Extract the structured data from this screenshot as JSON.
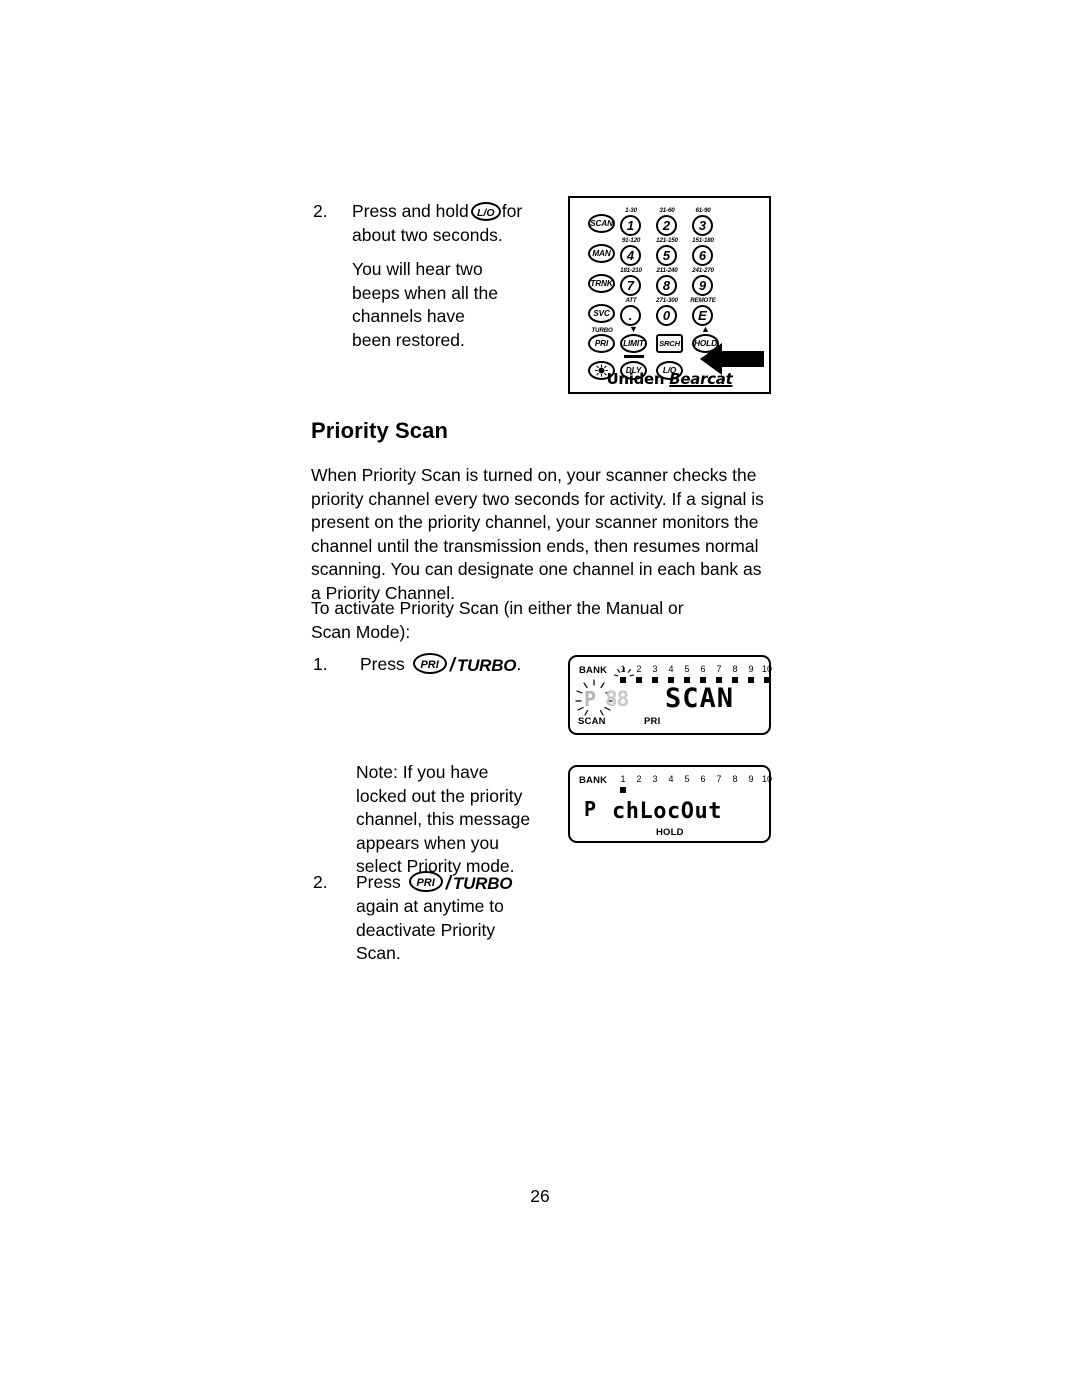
{
  "page": {
    "number": "26"
  },
  "step_restore": {
    "number": "2.",
    "line1_before": "Press and hold",
    "key_label": "L/O",
    "line1_after": "for",
    "line2": "about two seconds.",
    "para2_line1": "You will hear two",
    "para2_line2": "beeps when all the",
    "para2_line3": "channels have",
    "para2_line4": "been restored."
  },
  "section": {
    "heading": "Priority Scan",
    "paragraph_lines": [
      "When Priority Scan is turned on, your scanner checks the",
      "priority channel every two seconds for activity. If a signal is",
      "present on the priority channel, your scanner monitors the",
      "channel until the transmission ends, then resumes normal",
      "scanning. You can designate one channel in each bank as",
      "a Priority Channel."
    ],
    "activate_line1": "To activate Priority Scan (in either the Manual or",
    "activate_line2": "Scan Mode):"
  },
  "step_press_pri": {
    "number": "1.",
    "press_word": "Press",
    "key_label": "PRI",
    "slash": "/",
    "turbo_label": "TURBO",
    "period": "."
  },
  "note": {
    "line1": "Note: If you have",
    "line2": "locked out the priority",
    "line3": "channel, this message",
    "line4": "appears when you",
    "line5": "select Priority mode."
  },
  "step_deactivate": {
    "number": "2.",
    "press_word": "Press",
    "key_label": "PRI",
    "slash": "/",
    "turbo_label": "TURBO",
    "line2": "again at anytime to",
    "line3": "deactivate Priority",
    "line4": "Scan."
  },
  "keypad": {
    "brand_uniden": "Uniden",
    "brand_bearcat": "Bearcat",
    "left_column": [
      "SCAN",
      "MAN",
      "TRNK",
      "SVC",
      "PRI"
    ],
    "number_keys": [
      {
        "label": "1",
        "sublabel": "1-30"
      },
      {
        "label": "2",
        "sublabel": "31-60"
      },
      {
        "label": "3",
        "sublabel": "61-90"
      },
      {
        "label": "4",
        "sublabel": "91-120"
      },
      {
        "label": "5",
        "sublabel": "121-150"
      },
      {
        "label": "6",
        "sublabel": "151-180"
      },
      {
        "label": "7",
        "sublabel": "181-210"
      },
      {
        "label": "8",
        "sublabel": "211-240"
      },
      {
        "label": "9",
        "sublabel": "241-270"
      },
      {
        "label": ".",
        "sublabel": "ATT"
      },
      {
        "label": "0",
        "sublabel": "271-300"
      },
      {
        "label": "E",
        "sublabel": "REMOTE"
      }
    ],
    "function_row": [
      {
        "label": "PRI",
        "sublabel": "TURBO"
      },
      {
        "label": "LIMIT",
        "sublabel": ""
      },
      {
        "label": "SRCH",
        "sublabel": ""
      },
      {
        "label": "HOLD",
        "sublabel": ""
      }
    ],
    "bottom_row": [
      {
        "label": "LIGHT",
        "sublabel": ""
      },
      {
        "label": "DLY",
        "sublabel": ""
      },
      {
        "label": "L/O",
        "sublabel": ""
      }
    ]
  },
  "lcd_scan": {
    "bank_word": "BANK",
    "bank_numbers": [
      "1",
      "2",
      "3",
      "4",
      "5",
      "6",
      "7",
      "8",
      "9",
      "10"
    ],
    "active_bank": "1",
    "p_indicator": "P",
    "ghost_digits": "88",
    "main_text": "SCAN",
    "foot_left": "SCAN",
    "foot_mid": "PRI"
  },
  "lcd_lockout": {
    "bank_word": "BANK",
    "bank_numbers": [
      "1",
      "2",
      "3",
      "4",
      "5",
      "6",
      "7",
      "8",
      "9",
      "10"
    ],
    "active_bank": "1",
    "p_indicator": "P",
    "main_text": "chLocOut",
    "foot_mid": "HOLD"
  }
}
